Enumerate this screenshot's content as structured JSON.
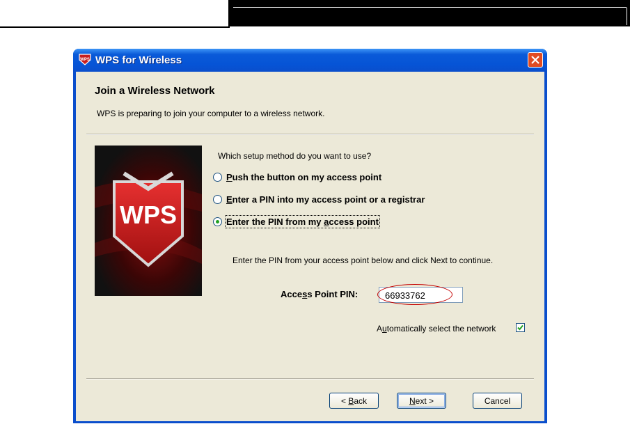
{
  "window": {
    "title": "WPS for Wireless"
  },
  "page": {
    "heading": "Join a Wireless Network",
    "description": "WPS is preparing to join your computer to a wireless network."
  },
  "setup": {
    "question": "Which setup method do you want to use?",
    "options": [
      {
        "before": "",
        "key": "P",
        "after": "ush the button on my access point",
        "selected": false
      },
      {
        "before": "",
        "key": "E",
        "after": "nter a PIN into my access point or a registrar",
        "selected": false
      },
      {
        "before": "Enter the PIN from my ",
        "key": "a",
        "after": "ccess point",
        "selected": true
      }
    ]
  },
  "pin": {
    "instruction": "Enter the PIN from your access point below and click Next to continue.",
    "label_before": "Acce",
    "label_key": "s",
    "label_after": "s Point PIN:",
    "value": "66933762"
  },
  "auto_select": {
    "label_before": "A",
    "label_key": "u",
    "label_after": "tomatically select the network",
    "checked": true
  },
  "logo": {
    "text": "WPS"
  },
  "buttons": {
    "back_prefix": "< ",
    "back_key": "B",
    "back_rest": "ack",
    "next_key": "N",
    "next_rest": "ext >",
    "cancel": "Cancel"
  },
  "colors": {
    "titlebar": "#0a5ad8",
    "dialog_bg": "#ece9d8",
    "close_button": "#e14b22",
    "highlight_circle": "#c40000",
    "radio_dot": "#21a121",
    "logo_shield": "#c81e1e"
  },
  "icons": {
    "app": "wps-shield-icon",
    "close": "close-icon",
    "checkbox": "checkmark-icon"
  }
}
